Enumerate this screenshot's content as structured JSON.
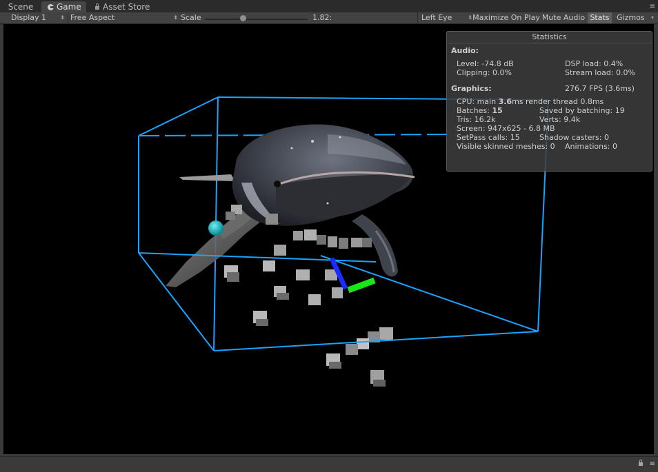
{
  "tabs": [
    {
      "label": "Scene"
    },
    {
      "label": "Game"
    },
    {
      "label": "Asset Store"
    }
  ],
  "toolbar": {
    "display": "Display 1",
    "aspect": "Free Aspect",
    "scale_label": "Scale",
    "scale_value": "1.82:",
    "eye": "Left Eye",
    "maximize": "Maximize On Play",
    "mute": "Mute Audio",
    "stats": "Stats",
    "gizmos": "Gizmos"
  },
  "icons": {
    "tab_menu": "≡",
    "dropdown": "⬍",
    "gizmos_arrow": "▾",
    "game_tab": "pacman-icon",
    "store_tab": "lock-icon"
  },
  "stats": {
    "title": "Statistics",
    "audio_header": "Audio:",
    "level": "Level: -74.8 dB",
    "dsp": "DSP load: 0.4%",
    "clipping": "Clipping: 0.0%",
    "stream": "Stream load: 0.0%",
    "graphics_header": "Graphics:",
    "fps": "276.7 FPS (3.6ms)",
    "cpu_prefix": "CPU: main ",
    "cpu_main": "3.6",
    "cpu_suffix": "ms  render thread 0.8ms",
    "batches_prefix": "Batches: ",
    "batches": "15",
    "saved": "Saved by batching: 19",
    "tris": "Tris: 16.2k",
    "verts": "Verts: 9.4k",
    "screen": "Screen: 947x625 - 6.8 MB",
    "setpass": "SetPass calls: 15",
    "shadow": "Shadow casters: 0",
    "skinned": "Visible skinned meshes: 0",
    "animations": "Animations: 0"
  },
  "colors": {
    "gizmo_box": "#1aa3ff",
    "handle_blue": "#1a2cff",
    "handle_green": "#19e619",
    "sphere": "#19b3bf"
  }
}
